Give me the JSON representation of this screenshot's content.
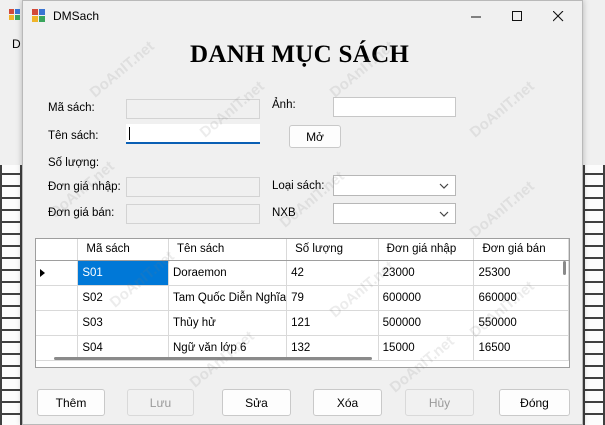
{
  "window": {
    "title": "DMSach"
  },
  "background": {
    "menu_stub": "D"
  },
  "heading": "DANH MỤC SÁCH",
  "form": {
    "ma_sach_label": "Mã sách:",
    "ten_sach_label": "Tên sách:",
    "so_luong_label": "Số lượng:",
    "don_gia_nhap_label": "Đơn giá nhập:",
    "don_gia_ban_label": "Đơn giá bán:",
    "anh_label": "Ảnh:",
    "loai_sach_label": "Loại sách:",
    "nxb_label": "NXB",
    "mo_button": "Mở",
    "ma_sach_value": "",
    "ten_sach_value": "",
    "so_luong_value": "",
    "don_gia_nhap_value": "",
    "don_gia_ban_value": "",
    "anh_value": "",
    "loai_sach_value": "",
    "nxb_value": ""
  },
  "grid": {
    "columns": [
      "Mã sách",
      "Tên sách",
      "Số lượng",
      "Đơn giá nhập",
      "Đơn giá bán"
    ],
    "rows": [
      [
        "S01",
        "Doraemon",
        "42",
        "23000",
        "25300"
      ],
      [
        "S02",
        "Tam Quốc Diễn Nghĩa",
        "79",
        "600000",
        "660000"
      ],
      [
        "S03",
        "Thủy hử",
        "121",
        "500000",
        "550000"
      ],
      [
        "S04",
        "Ngữ văn lớp 6",
        "132",
        "15000",
        "16500"
      ]
    ],
    "selected_row": 0
  },
  "buttons": {
    "them": "Thêm",
    "luu": "Lưu",
    "sua": "Sửa",
    "xoa": "Xóa",
    "huy": "Hủy",
    "dong": "Đóng"
  },
  "watermark": "DoAnIT.net",
  "icons": [
    "app-icon",
    "minimize-icon",
    "maximize-icon",
    "close-icon",
    "chevron-down-icon",
    "row-pointer-icon"
  ],
  "colors": {
    "selection": "#0078d7",
    "focus_underline": "#0a5fb4"
  }
}
